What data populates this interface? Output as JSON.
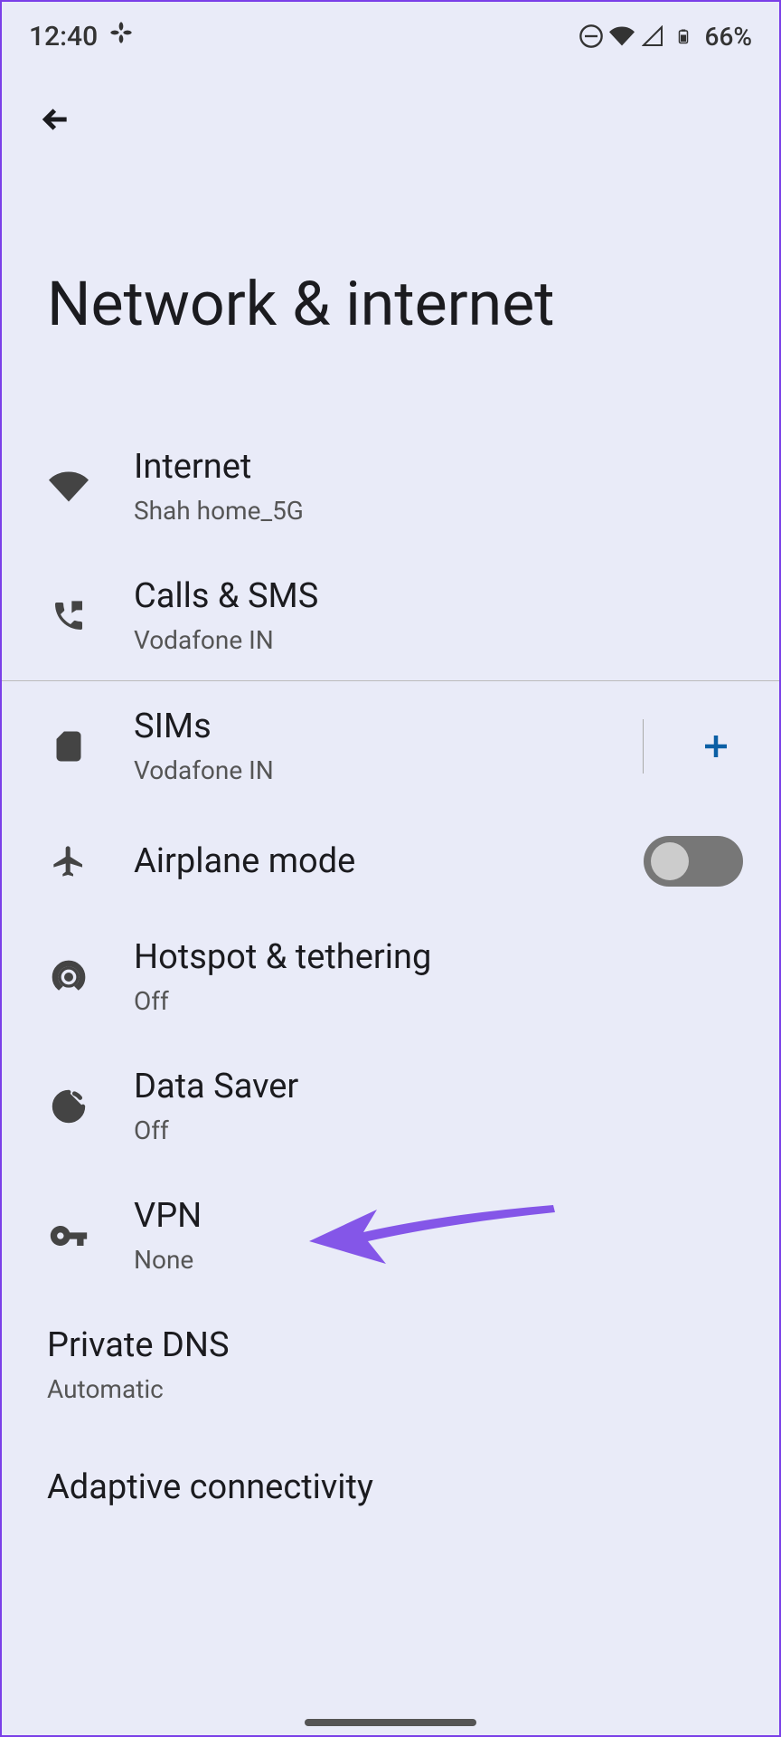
{
  "statusBar": {
    "time": "12:40",
    "batteryPercent": "66%"
  },
  "pageTitle": "Network & internet",
  "settings": {
    "internet": {
      "title": "Internet",
      "subtitle": "Shah home_5G"
    },
    "callsSms": {
      "title": "Calls & SMS",
      "subtitle": "Vodafone IN"
    },
    "sims": {
      "title": "SIMs",
      "subtitle": "Vodafone IN"
    },
    "airplaneMode": {
      "title": "Airplane mode"
    },
    "hotspot": {
      "title": "Hotspot & tethering",
      "subtitle": "Off"
    },
    "dataSaver": {
      "title": "Data Saver",
      "subtitle": "Off"
    },
    "vpn": {
      "title": "VPN",
      "subtitle": "None"
    },
    "privateDns": {
      "title": "Private DNS",
      "subtitle": "Automatic"
    },
    "adaptiveConnectivity": {
      "title": "Adaptive connectivity"
    }
  }
}
